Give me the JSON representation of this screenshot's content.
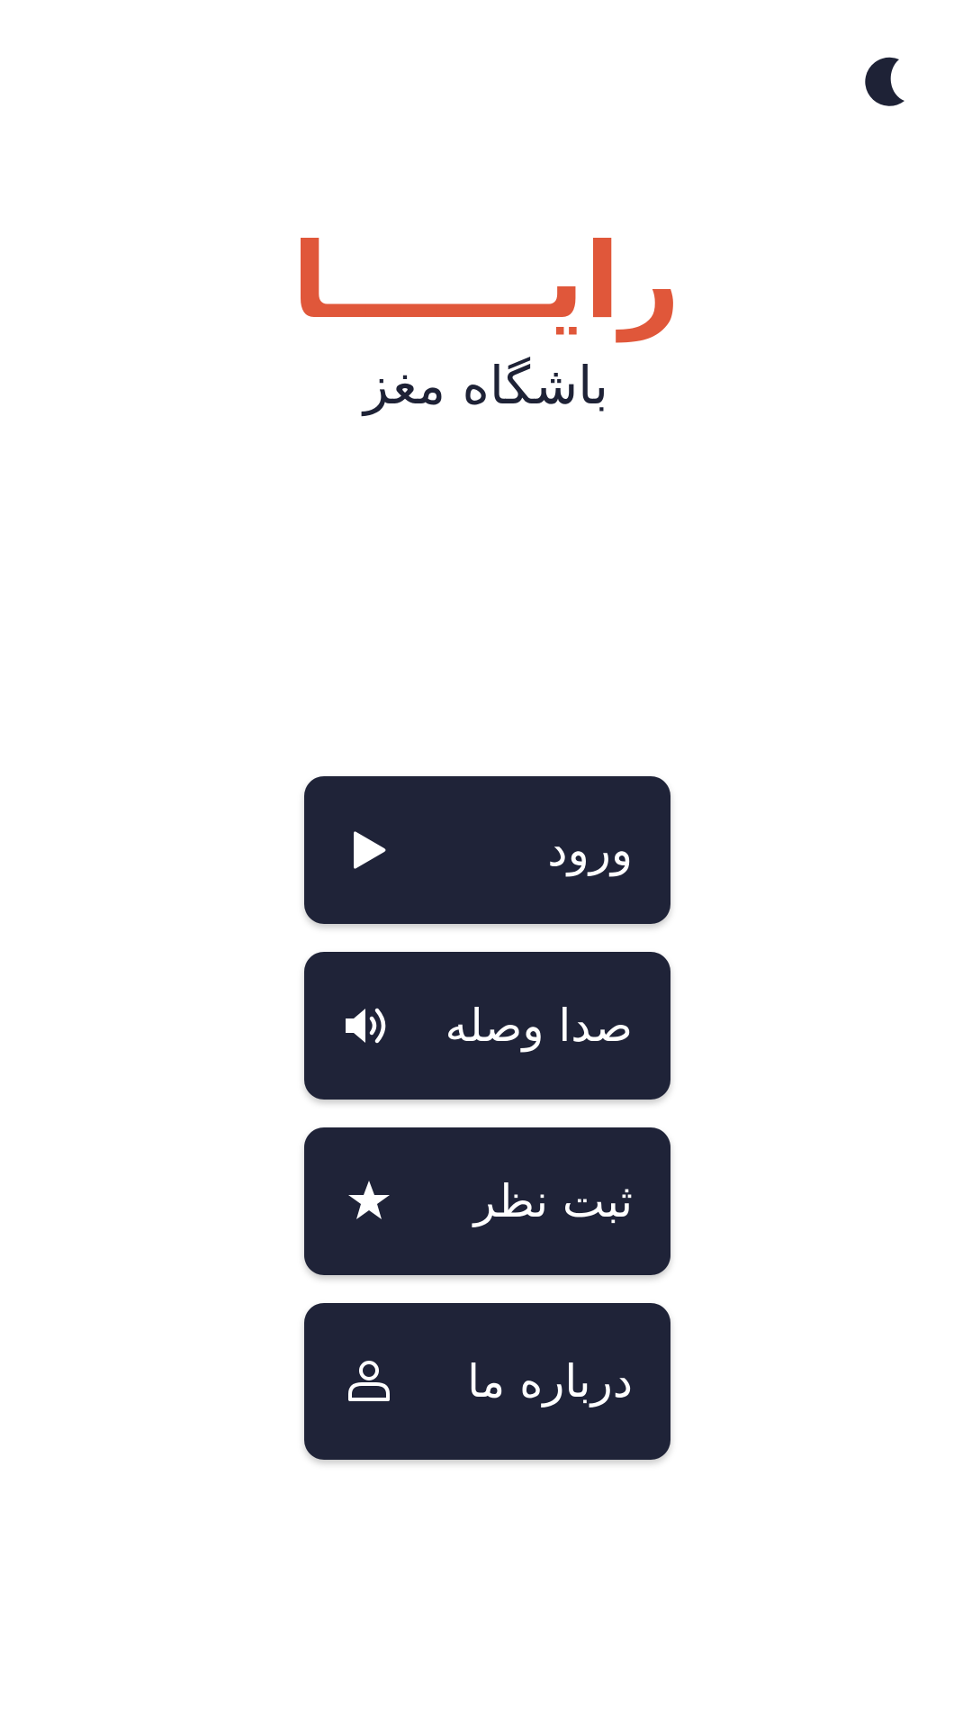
{
  "header": {
    "title": "رایــــــا",
    "subtitle": "باشگاه مغز"
  },
  "theme_toggle": {
    "icon": "moon-icon"
  },
  "menu": {
    "items": [
      {
        "label": "ورود",
        "icon": "play-icon"
      },
      {
        "label": "صدا وصله",
        "icon": "volume-icon"
      },
      {
        "label": "ثبت نظر",
        "icon": "star-icon"
      },
      {
        "label": "درباره ما",
        "icon": "user-icon"
      }
    ]
  },
  "colors": {
    "accent": "#e0573a",
    "button_background": "#1f2338",
    "text_dark": "#1e2236",
    "background": "#ffffff"
  }
}
